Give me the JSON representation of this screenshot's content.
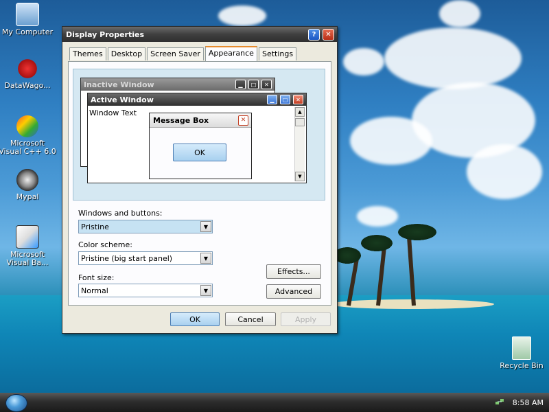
{
  "desktop": {
    "icons": [
      {
        "label": "My Computer",
        "glyph": "my-computer-icon"
      },
      {
        "label": "DataWago...",
        "glyph": "datawagon-icon"
      },
      {
        "label": "Microsoft Visual C++ 6.0",
        "glyph": "visual-cpp-icon"
      },
      {
        "label": "Mypal",
        "glyph": "mypal-icon"
      },
      {
        "label": "Microsoft Visual Ba...",
        "glyph": "visual-basic-icon"
      },
      {
        "label": "Recycle Bin",
        "glyph": "recycle-bin-icon"
      }
    ]
  },
  "dialog": {
    "title": "Display Properties",
    "help_symbol": "?",
    "close_symbol": "✕",
    "tabs": [
      {
        "label": "Themes"
      },
      {
        "label": "Desktop"
      },
      {
        "label": "Screen Saver"
      },
      {
        "label": "Appearance",
        "active": true
      },
      {
        "label": "Settings"
      }
    ],
    "preview": {
      "inactive_title": "Inactive Window",
      "active_title": "Active Window",
      "window_text": "Window Text",
      "message_title": "Message Box",
      "message_ok": "OK"
    },
    "windows_buttons": {
      "label": "Windows and buttons:",
      "value": "Pristine"
    },
    "color_scheme": {
      "label": "Color scheme:",
      "value": "Pristine (big start panel)"
    },
    "font_size": {
      "label": "Font size:",
      "value": "Normal"
    },
    "effects_label": "Effects...",
    "advanced_label": "Advanced",
    "ok_label": "OK",
    "cancel_label": "Cancel",
    "apply_label": "Apply"
  },
  "taskbar": {
    "clock": "8:58 AM"
  },
  "colors": {
    "accent_blue": "#a8d0ef",
    "tab_highlight": "#e68b2c",
    "close_red": "#c23e22"
  }
}
